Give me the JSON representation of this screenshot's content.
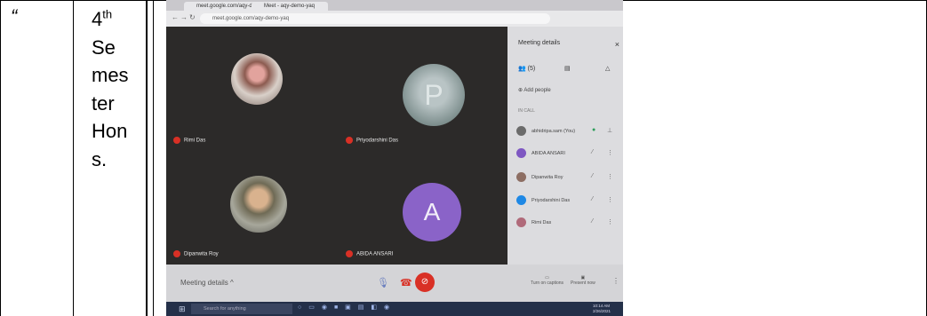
{
  "table": {
    "quote_mark": "“",
    "semester": {
      "number": "4",
      "suffix": "th",
      "lines": [
        "Se",
        "mes",
        "ter",
        "Hon",
        "s."
      ]
    }
  },
  "photo": {
    "browser": {
      "tab1": "meet.google.com/aqy-demo-yaq",
      "tab2": "Meet - aqy-demo-yaq",
      "url": "meet.google.com/aqy-demo-yaq"
    },
    "tiles": [
      {
        "name": "Rimi Das"
      },
      {
        "name": "Priyodarshini Das",
        "initial": "P"
      },
      {
        "name": "Dipanwita Roy"
      },
      {
        "name": "ABIDA ANSARI",
        "initial": "A"
      }
    ],
    "panel": {
      "title": "Meeting details",
      "close": "×",
      "people_count": "(5)",
      "add_people": "Add people",
      "in_call": "IN CALL",
      "participants": [
        {
          "name": "abhidripa.sam (You)",
          "color": "#6b6b6b"
        },
        {
          "name": "ABIDA ANSARI",
          "color": "#7e57c2"
        },
        {
          "name": "Dipanwita Roy",
          "color": "#8d6e63"
        },
        {
          "name": "Priyodarshini Das",
          "color": "#1e88e5"
        },
        {
          "name": "Rimi Das",
          "color": "#b06a7a"
        }
      ]
    },
    "bottom": {
      "meeting_details": "Meeting details ^",
      "captions": "Turn on captions",
      "present": "Present now"
    },
    "taskbar": {
      "search": "Search for anything",
      "time": "10:14 AM",
      "date": "2/26/2021"
    }
  }
}
